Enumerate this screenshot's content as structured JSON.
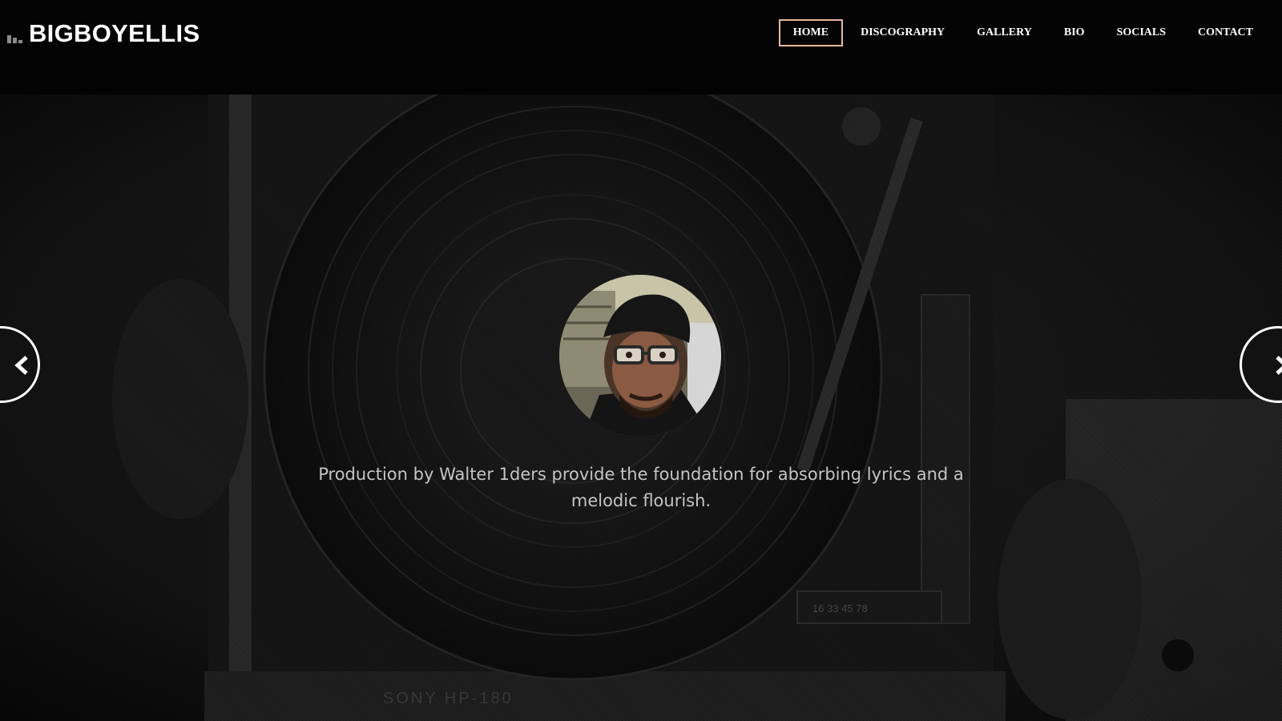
{
  "header": {
    "brand": {
      "icon": "equalizer-bars-icon",
      "title": "BIGBOYELLIS"
    },
    "nav": [
      {
        "label": "HOME",
        "active": true
      },
      {
        "label": "DISCOGRAPHY",
        "active": false
      },
      {
        "label": "GALLERY",
        "active": false
      },
      {
        "label": "BIO",
        "active": false
      },
      {
        "label": "SOCIALS",
        "active": false
      },
      {
        "label": "CONTACT",
        "active": false
      }
    ],
    "active_border_color": "#e8b79a"
  },
  "hero": {
    "background": "turntable-photo",
    "avatar": "artist-portrait",
    "caption": "Production by Walter 1ders provide the foundation for absorbing lyrics and a melodic flourish.",
    "prev_icon": "chevron-left-icon",
    "next_icon": "chevron-right-icon"
  }
}
